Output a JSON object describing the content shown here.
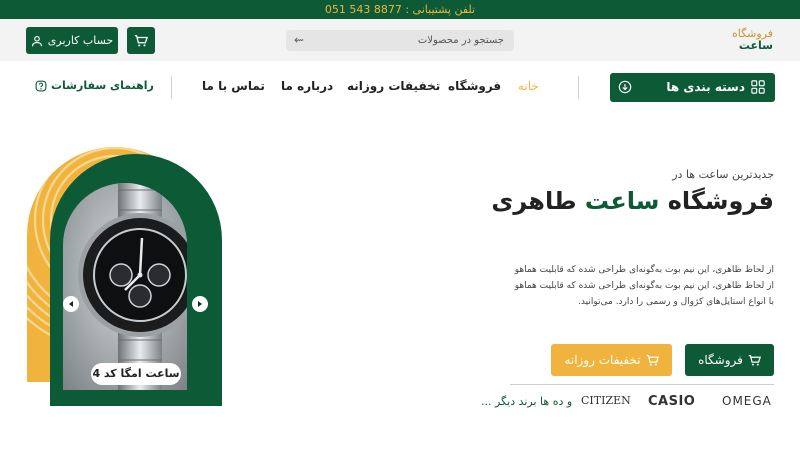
{
  "topbar": {
    "phone_text": "تلفن پشتیبانی : 8877 543 051"
  },
  "header": {
    "logo_line1": "فروشگاه",
    "logo_line2": "ساعت",
    "search_placeholder": "جستجو در محصولات",
    "account_button": "حساب کاربری"
  },
  "nav": {
    "categories_button": "دسته بندی ها",
    "links": [
      "خانه",
      "فروشگاه",
      "تخفیفات روزانه",
      "درباره ما",
      "تماس با ما"
    ],
    "active_index": 0,
    "order_guide": "راهنمای سفارشات"
  },
  "hero": {
    "eyebrow": "جدیدترین ساعت ها در",
    "title_part1": "فروشگاه ",
    "title_highlight": "ساعت",
    "title_part2": " طاهری",
    "description": [
      "از لحاظ ظاهری، این نیم بوت به‌گونه‌ای طراحی شده که قابلیت هماهو",
      "از لحاظ ظاهری، این نیم بوت به‌گونه‌ای طراحی شده که قابلیت هماهو",
      "با انواع استایل‌های کژوال و رسمی را دارد. می‌توانید."
    ],
    "shop_button": "فروشگاه",
    "deals_button": "تخفیفات روزانه",
    "product_caption": "ساعت امگا کد 4"
  },
  "brands": {
    "items": [
      "OMEGA",
      "CASIO",
      "CITIZEN"
    ],
    "more": "و ده ها برند دیگر ..."
  },
  "colors": {
    "primary": "#0d5a37",
    "accent": "#f0b43e",
    "header_bg": "#f3f3f3"
  }
}
